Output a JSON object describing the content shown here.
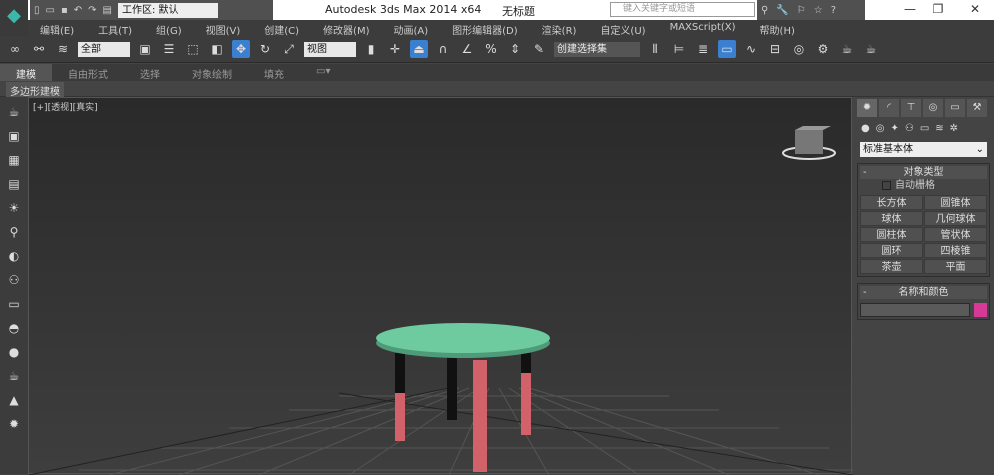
{
  "title": {
    "app": "Autodesk 3ds Max  2014 x64",
    "document": "无标题",
    "workspace": "工作区: 默认",
    "search_placeholder": "键入关键字或短语"
  },
  "menu": [
    "编辑(E)",
    "工具(T)",
    "组(G)",
    "视图(V)",
    "创建(C)",
    "修改器(M)",
    "动画(A)",
    "图形编辑器(D)",
    "渲染(R)",
    "自定义(U)",
    "MAXScript(X)",
    "帮助(H)"
  ],
  "toolbar": {
    "filter": "全部",
    "ref_coord": "视图",
    "selection_set": "创建选择集"
  },
  "ribbon": {
    "tabs": [
      "建模",
      "自由形式",
      "选择",
      "对象绘制",
      "填充"
    ],
    "sub": "多边形建模"
  },
  "viewport": {
    "label": "[+][透视][真实]"
  },
  "panel": {
    "category": "标准基本体",
    "object_type": {
      "title": "对象类型",
      "autogrid": "自动栅格",
      "buttons": [
        "长方体",
        "圆锥体",
        "球体",
        "几何球体",
        "圆柱体",
        "管状体",
        "圆环",
        "四棱锥",
        "茶壶",
        "平面"
      ]
    },
    "name_color": {
      "title": "名称和颜色",
      "color": "#d63a96"
    }
  },
  "colors": {
    "tabletop": "#6ecb9f",
    "legs": "#d2626a"
  }
}
